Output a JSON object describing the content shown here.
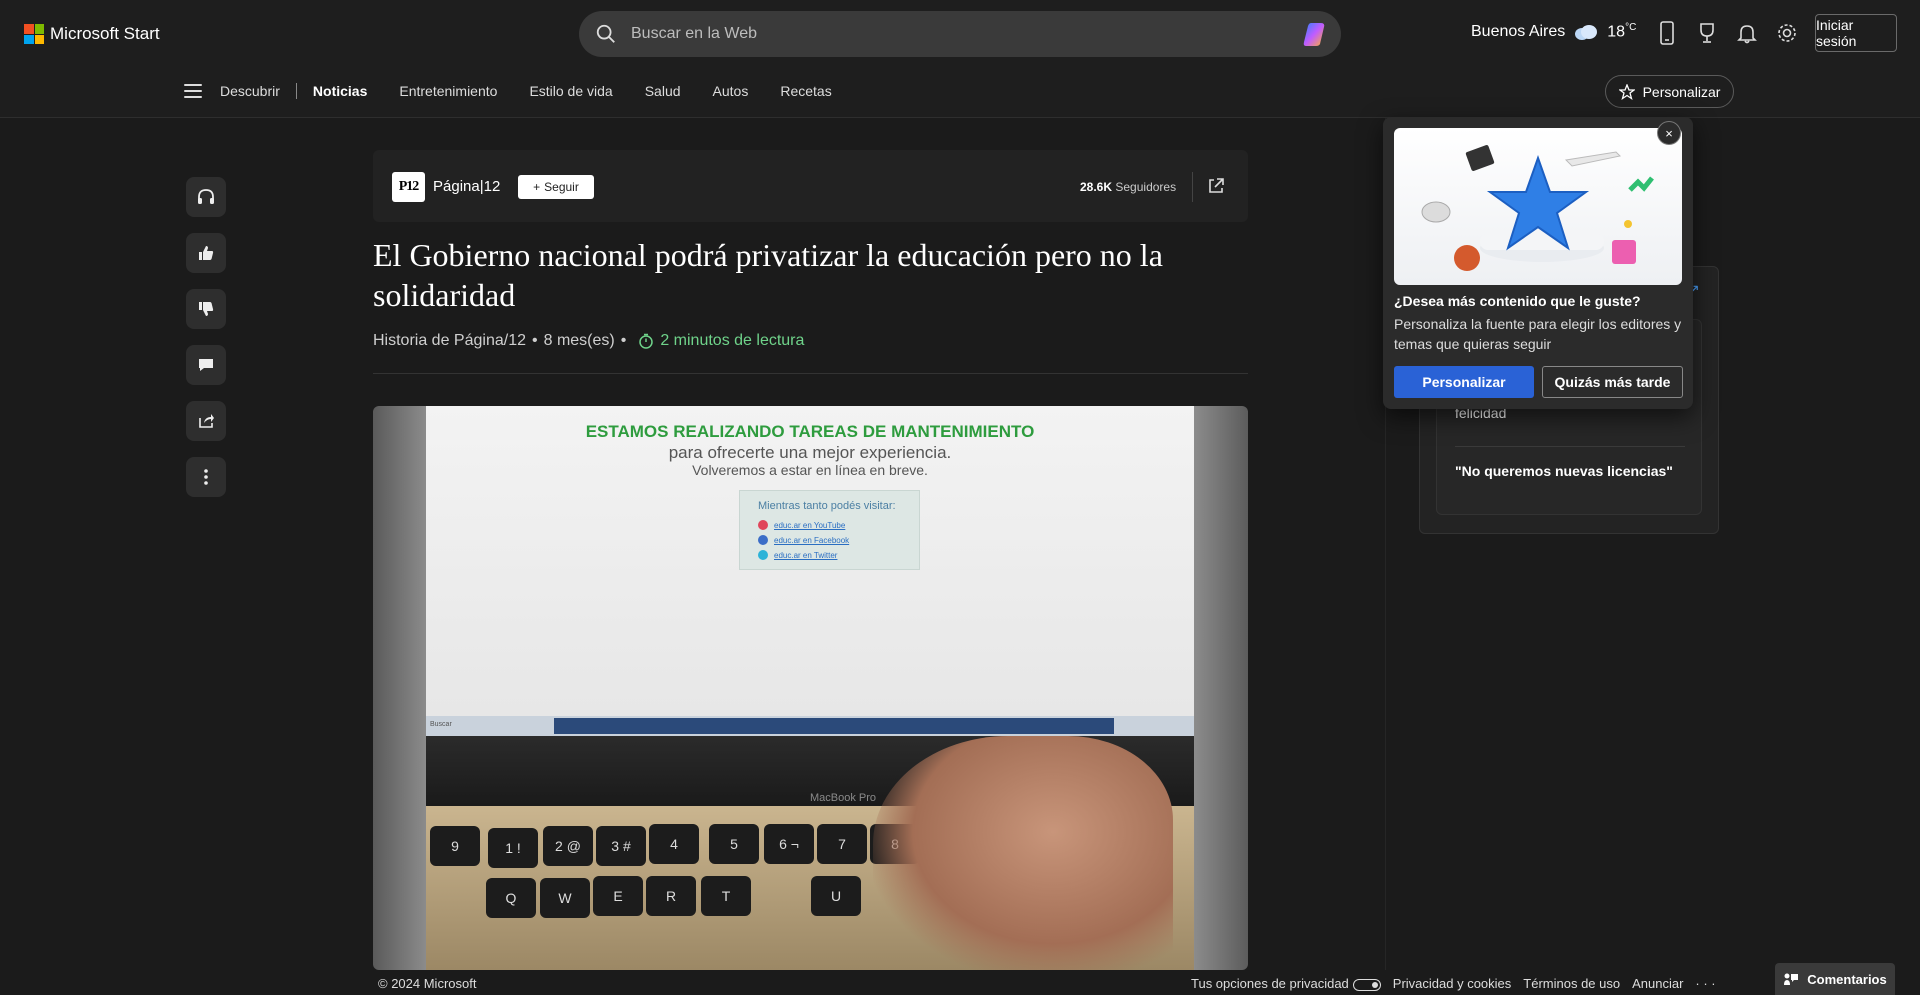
{
  "header": {
    "brand": "Microsoft Start",
    "search_placeholder": "Buscar en la Web",
    "weather_city": "Buenos Aires",
    "weather_temp": "18",
    "weather_unit": "°C",
    "signin_label": "Iniciar sesión"
  },
  "nav": {
    "items": [
      "Descubrir",
      "Noticias",
      "Entretenimiento",
      "Estilo de vida",
      "Salud",
      "Autos",
      "Recetas"
    ],
    "active": "Noticias",
    "personalize_label": "Personalizar"
  },
  "article": {
    "publisher_logo_text": "P12",
    "publisher": "Página|12",
    "follow_label": "Seguir",
    "followers_count": "28.6K",
    "followers_label": "Seguidores",
    "headline": "El Gobierno nacional podrá privatizar la educación pero no la solidaridad",
    "byline_source": "Historia de Página/12",
    "byline_sep": "•",
    "byline_age": "8 mes(es)",
    "read_time": "2 minutos de lectura"
  },
  "hero_image": {
    "title": "ESTAMOS REALIZANDO TAREAS DE MANTENIMIENTO",
    "subtitle": "para ofrecerte una mejor experiencia.",
    "subtitle2": "Volveremos a estar en línea en breve.",
    "visit_title": "Mientras tanto podés visitar:",
    "links": [
      "educ.ar en YouTube",
      "educ.ar en Facebook",
      "educ.ar en Twitter"
    ],
    "taskbar_search": "Buscar",
    "laptop_label": "MacBook Pro",
    "keys_row1": [
      "9",
      "1 !",
      "2 @",
      "3 #",
      "4",
      "5",
      "6 ¬",
      "7",
      "8"
    ],
    "keys_row2": [
      "Q",
      "W",
      "E",
      "R",
      "T",
      "U"
    ]
  },
  "right_rail": {
    "items": [
      "felicidad",
      "\"No queremos nuevas licencias\""
    ]
  },
  "popup": {
    "title": "¿Desea más contenido que le guste?",
    "text": "Personaliza la fuente para elegir los editores y temas que quieras seguir",
    "primary_label": "Personalizar",
    "secondary_label": "Quizás más tarde",
    "close_glyph": "×"
  },
  "footer": {
    "copyright": "© 2024 Microsoft",
    "privacy_choices": "Tus opciones de privacidad",
    "links": [
      "Privacidad y cookies",
      "Términos de uso",
      "Anunciar"
    ],
    "more": "· · ·",
    "comments_label": "Comentarios"
  },
  "icons": {
    "rail": [
      "headphones-icon",
      "thumbs-up-icon",
      "thumbs-down-icon",
      "comment-icon",
      "share-icon",
      "more-vertical-icon"
    ],
    "header": [
      "mobile-icon",
      "trophy-icon",
      "bell-icon",
      "gear-icon"
    ]
  },
  "colors": {
    "accent_blue": "#2a62d6",
    "read_time_green": "#6fd38a",
    "maintenance_green": "#2e9c3e"
  }
}
